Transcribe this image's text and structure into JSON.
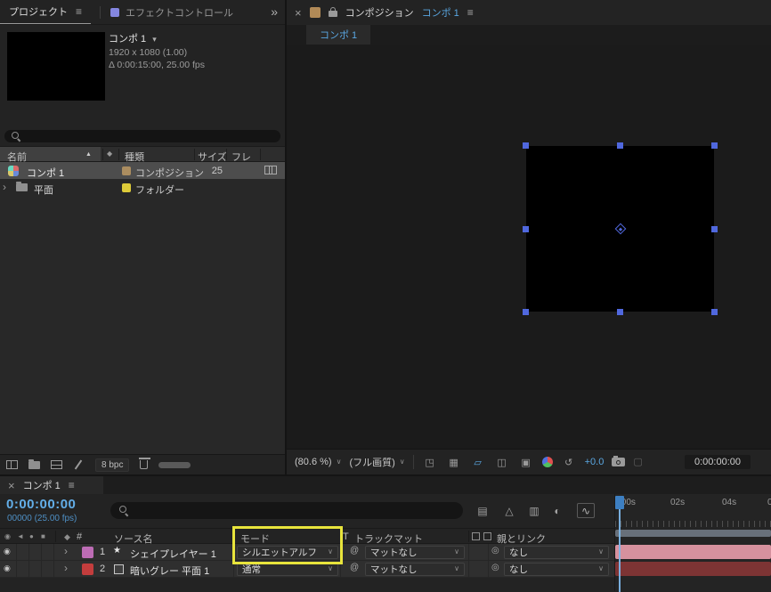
{
  "colors": {
    "accent_blue": "#5aa7e2",
    "timecode_blue": "#63aee8",
    "frames_blue": "#4e8fc4",
    "highlight_yellow": "#e8e43c",
    "selection_blue": "#5068de",
    "layer1_label": "#bd6cb5",
    "layer2_label": "#c33d3d",
    "layer1_bar": "#d6919e",
    "layer2_bar": "#7d3434",
    "workarea_gray": "#68707a"
  },
  "icons": {
    "menu": "≡",
    "close": "×",
    "overflow": "»",
    "caret_down": "∨",
    "triangle_down": "▾",
    "sort_asc": "▲",
    "twirl_closed": "›",
    "star": "★",
    "pick_whip": "@",
    "parent_pick_whip": "◎",
    "label_diamond": "◆",
    "eye": "◉",
    "audio": "◄",
    "solo": "●",
    "lock": "■",
    "grid_options": "◳",
    "transparency_grid": "▦",
    "mask_toggle": "▱",
    "region": "◫",
    "rulers": "▣",
    "reset_exposure": "↺",
    "snapshot_slot": "▢",
    "flowchart": "▤",
    "draft_3d": "△",
    "frame_blend": "▥",
    "motion_blur": "◐",
    "graph": "∿"
  },
  "project_panel": {
    "tab_project": "プロジェクト",
    "tab_effect_controls": "エフェクトコントロール",
    "preview": {
      "comp_name": "コンポ 1",
      "resolution": "1920 x 1080 (1.00)",
      "duration": "Δ 0:00:15:00, 25.00 fps"
    },
    "columns": {
      "name": "名前",
      "type": "種類",
      "size": "サイズ",
      "frame_rate": "フレ"
    },
    "rows": [
      {
        "name": "コンポ 1",
        "type": "コンポジション",
        "size": "25"
      },
      {
        "name": "平面",
        "type": "フォルダー",
        "size": ""
      }
    ],
    "footer": {
      "bpc": "8 bpc"
    }
  },
  "comp_panel": {
    "title": "コンポジション",
    "active_comp": "コンポ 1",
    "tab": "コンポ 1",
    "toolbar": {
      "zoom": "(80.6 %)",
      "quality": "(フル画質)",
      "exposure": "+0.0",
      "timecode": "0:00:00:00"
    }
  },
  "timeline_panel": {
    "tab": "コンポ 1",
    "timecode": "0:00:00:00",
    "frames": "00000 (25.00 fps)",
    "columns": {
      "number": "#",
      "source_name": "ソース名",
      "mode": "モード",
      "preserve": "T",
      "track_matte": "トラックマット",
      "parent_link": "親とリンク"
    },
    "layers": [
      {
        "num": "1",
        "name": "シェイプレイヤー 1",
        "mode": "シルエットアルフ",
        "matte": "マットなし",
        "parent": "なし"
      },
      {
        "num": "2",
        "name": "暗いグレー 平面 1",
        "mode": "通常",
        "matte": "マットなし",
        "parent": "なし"
      }
    ],
    "ruler_labels": [
      ":00s",
      "02s",
      "04s",
      "0"
    ]
  }
}
